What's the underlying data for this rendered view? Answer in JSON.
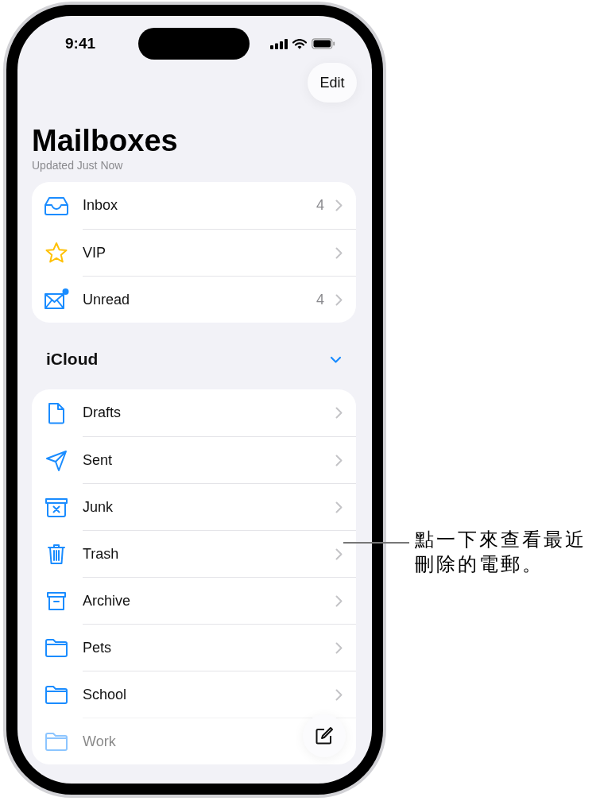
{
  "status_bar": {
    "time": "9:41"
  },
  "edit_button": "Edit",
  "title": "Mailboxes",
  "subtitle": "Updated Just Now",
  "mailboxes": [
    {
      "kind": "inbox",
      "label": "Inbox",
      "count": "4"
    },
    {
      "kind": "vip",
      "label": "VIP"
    },
    {
      "kind": "unread",
      "label": "Unread",
      "count": "4"
    }
  ],
  "account": {
    "name": "iCloud",
    "expanded": true,
    "folders": [
      {
        "kind": "drafts",
        "label": "Drafts",
        "faded": false
      },
      {
        "kind": "sent",
        "label": "Sent",
        "faded": false
      },
      {
        "kind": "junk",
        "label": "Junk",
        "faded": false
      },
      {
        "kind": "trash",
        "label": "Trash",
        "faded": false
      },
      {
        "kind": "archive",
        "label": "Archive",
        "faded": false
      },
      {
        "kind": "folder",
        "label": "Pets",
        "faded": false
      },
      {
        "kind": "folder",
        "label": "School",
        "faded": false
      },
      {
        "kind": "folder",
        "label": "Work",
        "faded": true
      }
    ]
  },
  "callout": "點一下來查看最近刪除的電郵。"
}
